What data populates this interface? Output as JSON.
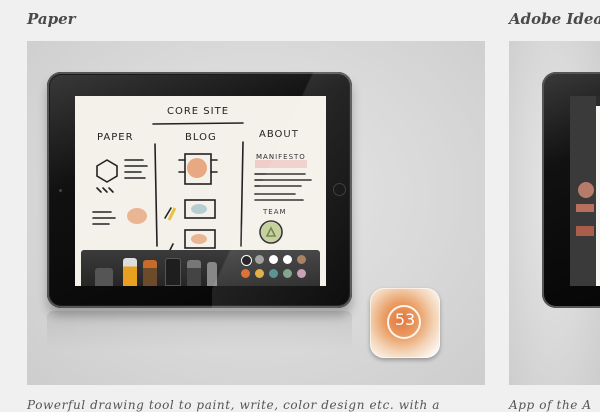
{
  "cards": [
    {
      "title": "Paper",
      "description": "Powerful drawing tool to paint, write, color design etc. with a",
      "sketch": {
        "heading": "CORE SITE",
        "columns": [
          "PAPER",
          "BLOG",
          "ABOUT"
        ],
        "labels": [
          "MANIFESTO",
          "TEAM"
        ]
      },
      "toolbar": {
        "tools": [
          "eraser-tool",
          "fountain-pen-tool",
          "pencil-tool",
          "marker-tool",
          "paintbrush-tool",
          "ink-pen-tool"
        ],
        "colors": [
          "#111111",
          "#9a9a9a",
          "#ffffff",
          "#ffffff",
          "#a47a5a",
          "#d9641f",
          "#e0a93a",
          "#4f8a8a",
          "#7a9f86",
          "#c69ab2",
          "#b48a6e"
        ]
      },
      "app_icon": {
        "number": "53"
      }
    },
    {
      "title": "Adobe Ideas",
      "description": "App of the A"
    }
  ]
}
